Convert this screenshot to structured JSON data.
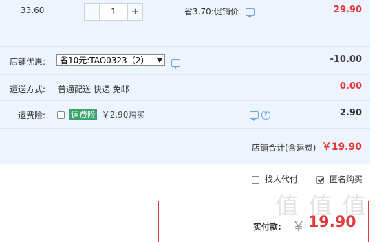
{
  "item": {
    "unit_price": "33.60",
    "minus_label": "-",
    "quantity": "1",
    "plus_label": "+",
    "saving_text": "省3.70:促销价",
    "subtotal": "29.90"
  },
  "shop_discount": {
    "label": "店铺优惠:",
    "selected_option": "省10元:TAO0323（2）",
    "amount": "-10.00"
  },
  "shipping": {
    "label": "运送方式:",
    "method": "普通配送 快递 免邮",
    "amount": "0.00"
  },
  "insurance": {
    "label": "运费险:",
    "tag": "运费险",
    "price_text": "￥2.90购买",
    "help_glyph": "?",
    "amount": "2.90"
  },
  "shop_total": {
    "label": "店铺合计(含运费)",
    "amount": "￥19.90"
  },
  "options": {
    "proxy_pay_label": "找人代付",
    "proxy_pay_checked": false,
    "anonymous_label": "匿名购买",
    "anonymous_checked": true
  },
  "payment": {
    "label": "实付款:",
    "currency": "￥",
    "amount": "19.90"
  },
  "watermark": "值 值 值",
  "colors": {
    "price_red": "#e4393c",
    "panel_bg": "#eef4fd",
    "tag_green": "#3aa36a",
    "icon_blue": "#6aa7e3"
  }
}
